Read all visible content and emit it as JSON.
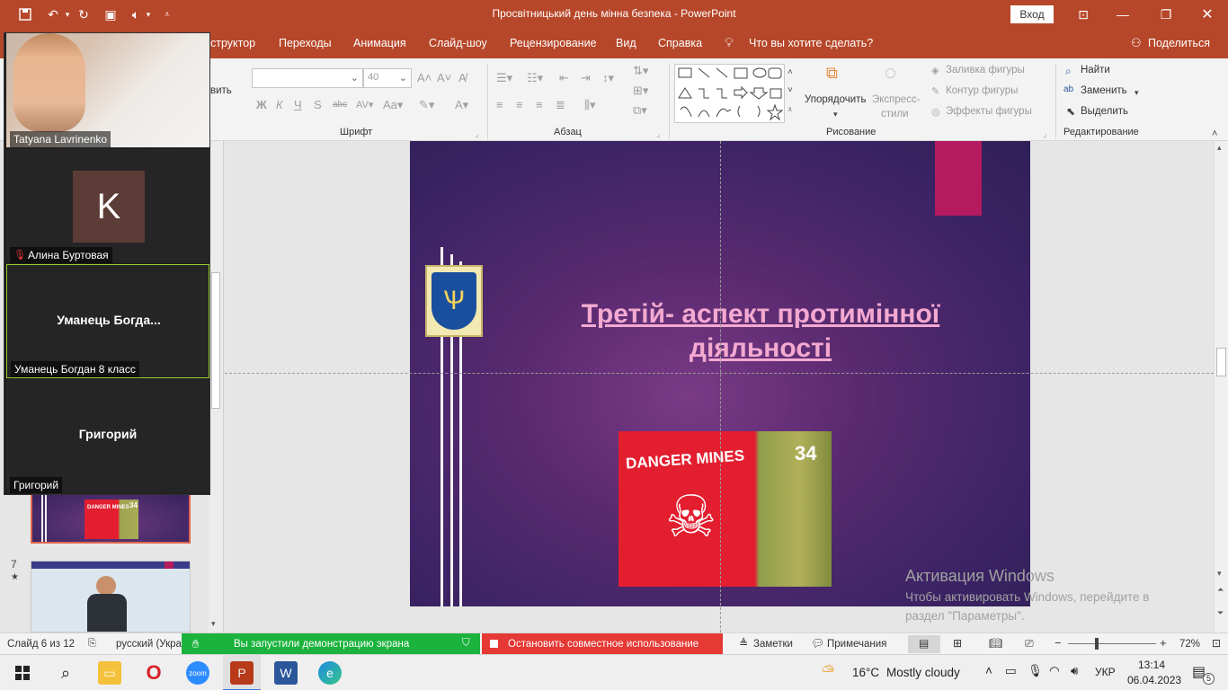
{
  "titlebar": {
    "doc_title": "Просвітницький день мінна безпека  -  PowerPoint",
    "signin_label": "Вход"
  },
  "tabs": {
    "items": [
      "структор",
      "Переходы",
      "Анимация",
      "Слайд-шоу",
      "Рецензирование",
      "Вид",
      "Справка"
    ],
    "tell_me": "Что вы хотите сделать?",
    "share": "Поделиться",
    "clipped_left": "вить"
  },
  "ribbon": {
    "font_size_value": "40",
    "groups": {
      "font": "Шрифт",
      "paragraph": "Абзац",
      "drawing": "Рисование",
      "editing": "Редактирование"
    },
    "drawing": {
      "arrange": "Упорядочить",
      "quick_styles_1": "Экспресс-",
      "quick_styles_2": "стили",
      "shape_fill": "Заливка фигуры",
      "shape_outline": "Контур фигуры",
      "shape_effects": "Эффекты фигуры"
    },
    "editing": {
      "find": "Найти",
      "replace": "Заменить",
      "select": "Выделить"
    }
  },
  "slide": {
    "title_line1": "Третій- аспект протимінної",
    "title_line2": "діяльності",
    "photo_text": "DANGER MINES",
    "photo_logo": "34"
  },
  "activation": {
    "title": "Активация Windows",
    "line1": "Чтобы активировать Windows, перейдите в",
    "line2": "раздел \"Параметры\"."
  },
  "thumbnails": {
    "slide7_num": "7",
    "slide7_star": "★"
  },
  "zoom": {
    "participants": [
      {
        "name": "Tatyana Lavrinenko"
      },
      {
        "name": "Алина Буртовая",
        "avatar_letter": "K"
      },
      {
        "name": "Уманець Богдан 8 класс",
        "display": "Уманець  Богда..."
      },
      {
        "name": "Григорий",
        "display": "Григорий"
      }
    ]
  },
  "statusbar": {
    "slide_counter": "Слайд 6 из 12",
    "language": "русский (Укра",
    "sharing_text": "Вы запустили демонстрацию экрана",
    "stop_sharing": "Остановить совместное использование",
    "notes": "Заметки",
    "comments": "Примечания",
    "zoom_level": "72%"
  },
  "taskbar": {
    "weather_temp": "16°C",
    "weather_text": "Mostly cloudy",
    "lang": "УКР",
    "time": "13:14",
    "date": "06.04.2023",
    "notification_count": "5"
  }
}
